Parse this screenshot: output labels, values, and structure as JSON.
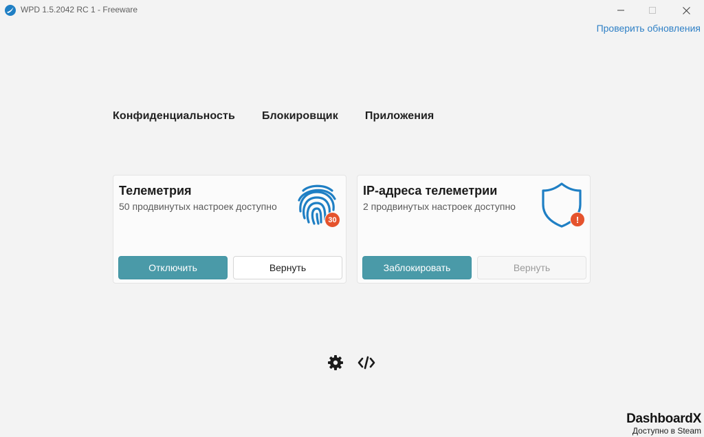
{
  "window": {
    "title": "WPD 1.5.2042 RC 1 - Freeware",
    "icons": {
      "logo": "wpd-logo-icon",
      "minimize": "minimize-icon",
      "maximize": "maximize-icon",
      "close": "close-icon"
    }
  },
  "header": {
    "update_link": "Проверить обновления"
  },
  "tabs": [
    {
      "label": "Конфиденциальность"
    },
    {
      "label": "Блокировщик"
    },
    {
      "label": "Приложения"
    }
  ],
  "cards": [
    {
      "title": "Телеметрия",
      "subtitle": "50 продвинутых настроек доступно",
      "icon": "fingerprint-icon",
      "badge": "30",
      "primary_label": "Отключить",
      "secondary_label": "Вернуть"
    },
    {
      "title": "IP-адреса телеметрии",
      "subtitle": "2 продвинутых настроек доступно",
      "icon": "shield-icon",
      "badge": "!",
      "primary_label": "Заблокировать",
      "secondary_label": "Вернуть"
    }
  ],
  "footer": {
    "icons": [
      "gear-icon",
      "code-icon"
    ]
  },
  "ad": {
    "brand": "DashboardX",
    "tagline": "Доступно в Steam"
  },
  "colors": {
    "accent": "#4a9aa8",
    "link": "#2f80c6",
    "badge": "#e5532d",
    "icon_blue": "#1f7fc4",
    "background": "#f3f3f3"
  }
}
